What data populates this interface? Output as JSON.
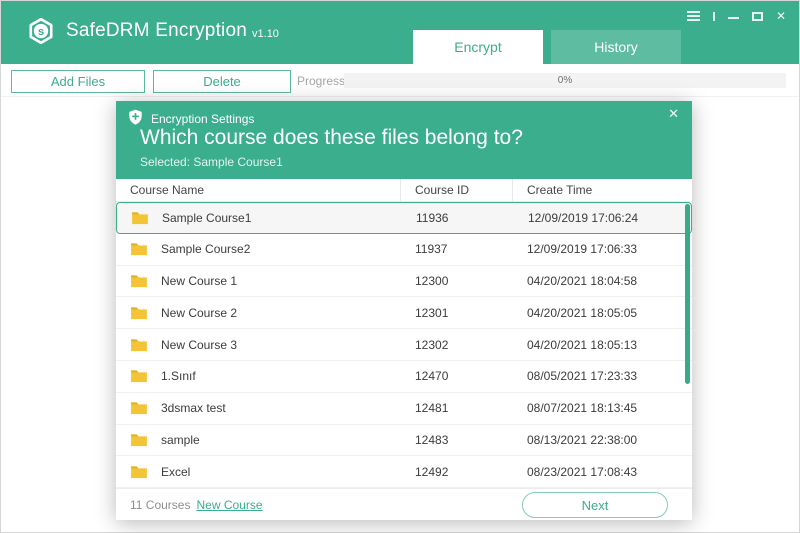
{
  "window": {
    "title": "SafeDRM Encryption",
    "version": "v1.10",
    "controls": {
      "close_glyph": "✕"
    }
  },
  "header": {
    "tabs": [
      {
        "label": "Encrypt",
        "active": true
      },
      {
        "label": "History",
        "active": false
      }
    ]
  },
  "toolbar": {
    "add_files": "Add Files",
    "delete": "Delete",
    "progress_label": "Progress",
    "progress_text": "0%",
    "progress_percent": 0
  },
  "dialog": {
    "title": "Encryption Settings",
    "close_glyph": "✕",
    "question": "Which course does these files belong to?",
    "selected": "Selected: Sample Course1",
    "table": {
      "columns": [
        "Course Name",
        "Course ID",
        "Create Time"
      ],
      "rows": [
        {
          "name": "Sample Course1",
          "id": "11936",
          "created": "12/09/2019 17:06:24",
          "selected": true
        },
        {
          "name": "Sample Course2",
          "id": "11937",
          "created": "12/09/2019 17:06:33"
        },
        {
          "name": "New Course 1",
          "id": "12300",
          "created": "04/20/2021 18:04:58"
        },
        {
          "name": "New Course 2",
          "id": "12301",
          "created": "04/20/2021 18:05:05"
        },
        {
          "name": "New Course 3",
          "id": "12302",
          "created": "04/20/2021 18:05:13"
        },
        {
          "name": "1.Sınıf",
          "id": "12470",
          "created": "08/05/2021 17:23:33"
        },
        {
          "name": "3dsmax test",
          "id": "12481",
          "created": "08/07/2021 18:13:45"
        },
        {
          "name": "sample",
          "id": "12483",
          "created": "08/13/2021 22:38:00"
        },
        {
          "name": "Excel",
          "id": "12492",
          "created": "08/23/2021 17:08:43"
        }
      ]
    },
    "footer": {
      "count": "11 Courses",
      "new_course": "New Course",
      "next": "Next"
    }
  },
  "colors": {
    "primary": "#3bae8d",
    "folder_yellow": "#f3c434",
    "progress_track": "#f3f3f3"
  }
}
